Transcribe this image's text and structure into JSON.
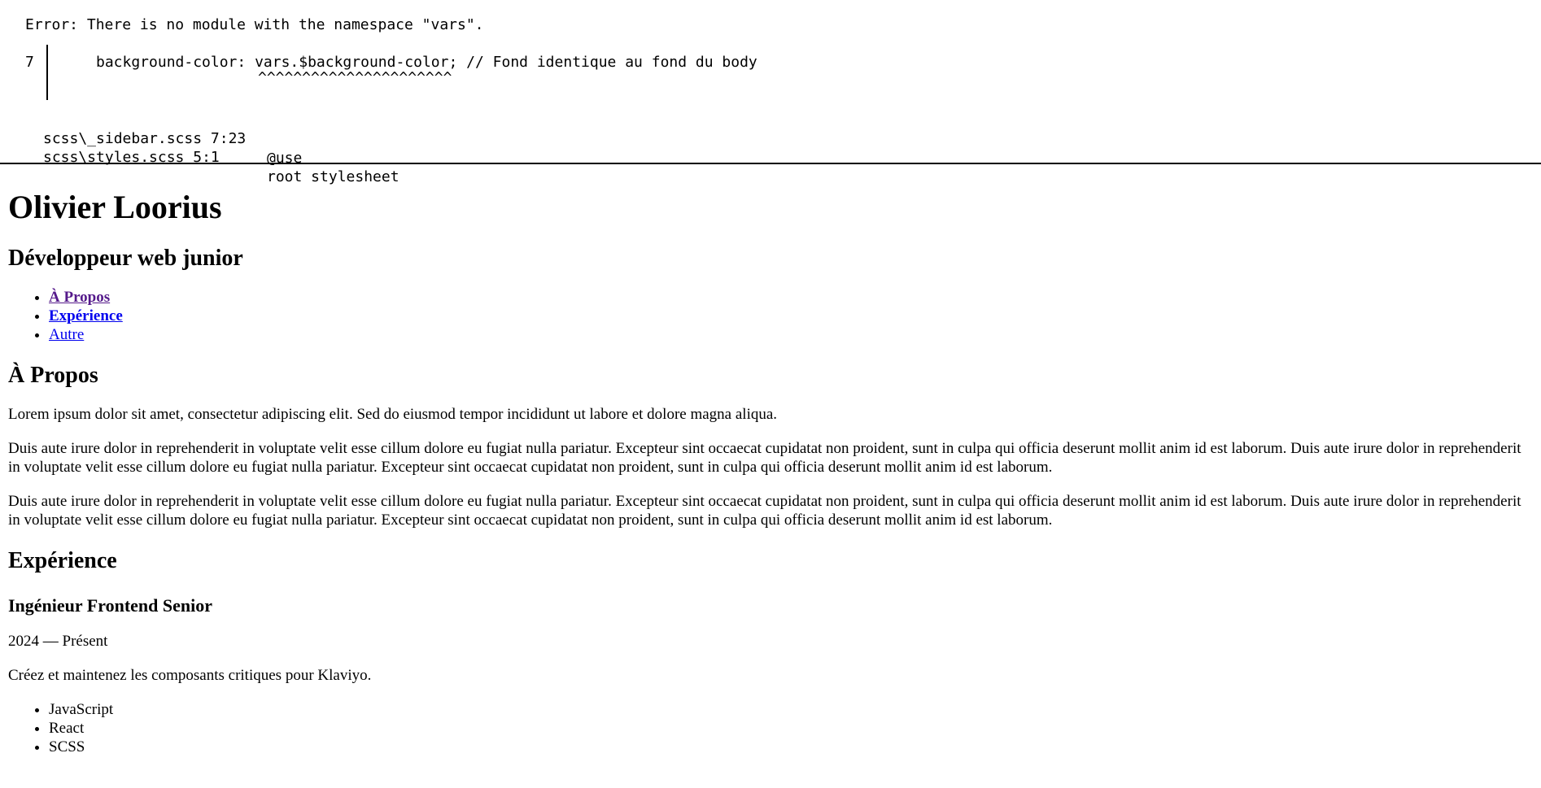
{
  "error": {
    "message": "Error: There is no module with the namespace \"vars\".",
    "line_number": "7",
    "code": "background-color: vars.$background-color; // Fond identique au fond du body",
    "carets": "^^^^^^^^^^^^^^^^^^^^^^",
    "trace": [
      {
        "location": "scss\\_sidebar.scss 7:23",
        "context": "@use"
      },
      {
        "location": "scss\\styles.scss 5:1",
        "context": "root stylesheet"
      }
    ]
  },
  "header": {
    "name": "Olivier Loorius",
    "role": "Développeur web junior"
  },
  "nav": {
    "items": [
      {
        "label": "À Propos"
      },
      {
        "label": "Expérience"
      },
      {
        "label": "Autre"
      }
    ]
  },
  "about": {
    "heading": "À Propos",
    "paragraphs": [
      "Lorem ipsum dolor sit amet, consectetur adipiscing elit. Sed do eiusmod tempor incididunt ut labore et dolore magna aliqua.",
      "Duis aute irure dolor in reprehenderit in voluptate velit esse cillum dolore eu fugiat nulla pariatur. Excepteur sint occaecat cupidatat non proident, sunt in culpa qui officia deserunt mollit anim id est laborum. Duis aute irure dolor in reprehenderit in voluptate velit esse cillum dolore eu fugiat nulla pariatur. Excepteur sint occaecat cupidatat non proident, sunt in culpa qui officia deserunt mollit anim id est laborum.",
      "Duis aute irure dolor in reprehenderit in voluptate velit esse cillum dolore eu fugiat nulla pariatur. Excepteur sint occaecat cupidatat non proident, sunt in culpa qui officia deserunt mollit anim id est laborum. Duis aute irure dolor in reprehenderit in voluptate velit esse cillum dolore eu fugiat nulla pariatur. Excepteur sint occaecat cupidatat non proident, sunt in culpa qui officia deserunt mollit anim id est laborum."
    ]
  },
  "experience": {
    "heading": "Expérience",
    "jobs": [
      {
        "title": "Ingénieur Frontend Senior",
        "period": "2024 — Présent",
        "description": "Créez et maintenez les composants critiques pour Klaviyo.",
        "skills": [
          "JavaScript",
          "React",
          "SCSS"
        ]
      }
    ]
  },
  "colors": {
    "link": "#0000ee",
    "link_visited": "#551a8b",
    "text": "#000000",
    "background": "#ffffff"
  }
}
